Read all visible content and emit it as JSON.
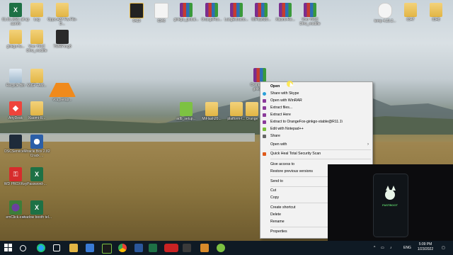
{
  "desktop_icons": [
    {
      "label": "01.01.2021 all ap aarohi"
    },
    {
      "label": "Log"
    },
    {
      "label": "Oppo A37 Fw-File-D..."
    },
    {
      "label": "6419"
    },
    {
      "label": "0346"
    },
    {
      "label": "ginkgo_global..."
    },
    {
      "label": "OrangeFox..."
    },
    {
      "label": "LangExtracto..."
    },
    {
      "label": "MiFlash20..."
    },
    {
      "label": "Xiaomi-Re..."
    },
    {
      "label": "Vivo Y91C Dfrw_modifie"
    },
    {
      "label": "temp 4.23.2..."
    },
    {
      "label": "0347"
    },
    {
      "label": "0348"
    },
    {
      "label": "ginkgo fw..."
    },
    {
      "label": "Vivo Y91C Dfrw_modifie"
    },
    {
      "label": "TWRPimg8"
    },
    {
      "label": "Recycle Bin"
    },
    {
      "label": "MIGP+AM..."
    },
    {
      "label": "vcu_setup..."
    },
    {
      "label": "AnyDesk"
    },
    {
      "label": "Xiaomi-R..."
    },
    {
      "label": "OrangeFox-ginkgo..."
    },
    {
      "label": "adb_setup..."
    },
    {
      "label": "MiFlash20..."
    },
    {
      "label": "platform-t..."
    },
    {
      "label": "Orange"
    },
    {
      "label": "DSCService..."
    },
    {
      "label": "Miracle Box 2.82 Crack ..."
    },
    {
      "label": "WD PROXKey"
    },
    {
      "label": "Password-..."
    },
    {
      "label": "emClick.exe"
    },
    {
      "label": "shadow booth tel..."
    }
  ],
  "context_menu": {
    "items": [
      {
        "label": "Open"
      },
      {
        "label": "Share with Skype"
      },
      {
        "label": "Open with WinRAR"
      },
      {
        "label": "Extract files..."
      },
      {
        "label": "Extract Here"
      },
      {
        "label": "Extract to OrangeFox-ginkgo-stable@R11.1\\"
      },
      {
        "label": "Edit with Notepad++"
      },
      {
        "label": "Share"
      },
      {
        "label": "Open with"
      },
      {
        "label": "Quick Heal Total Security Scan"
      },
      {
        "label": "Give access to"
      },
      {
        "label": "Restore previous versions"
      },
      {
        "label": "Send to"
      },
      {
        "label": "Cut"
      },
      {
        "label": "Copy"
      },
      {
        "label": "Create shortcut"
      },
      {
        "label": "Delete"
      },
      {
        "label": "Rename"
      },
      {
        "label": "Properties"
      }
    ]
  },
  "video_overlay": {
    "badge": "FASTBOOT"
  },
  "taskbar": {
    "language": "ENG",
    "time": "5:09 PM",
    "date": "1/23/2022"
  },
  "colors": {
    "taskbar": "#0f1a24",
    "menu_bg": "#f2f2f2",
    "folder": "#e2b544"
  }
}
